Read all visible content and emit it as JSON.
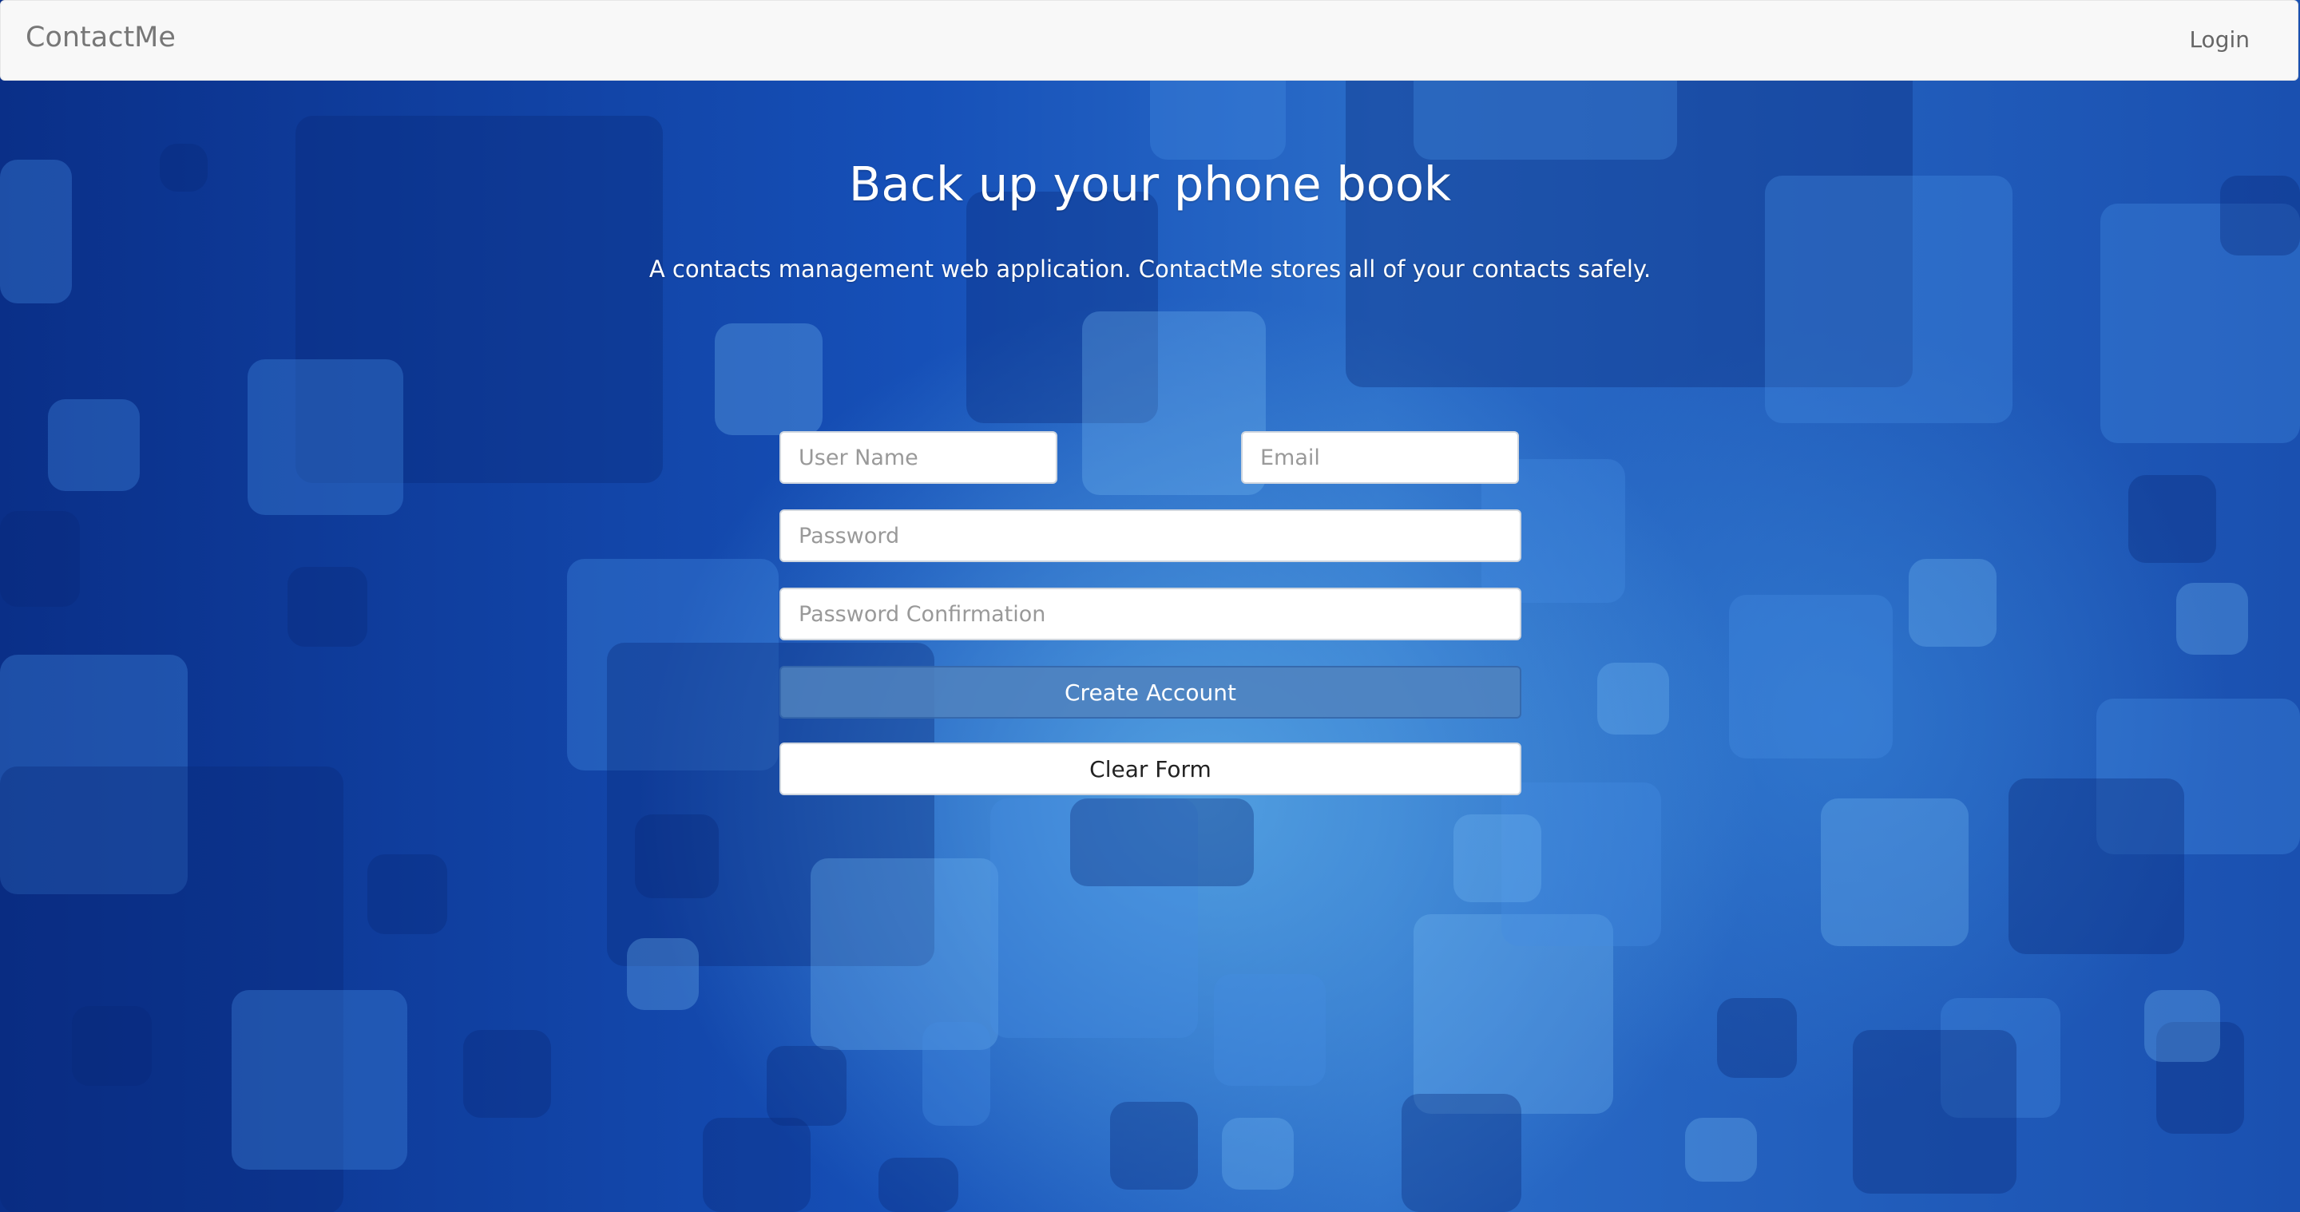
{
  "navbar": {
    "brand": "ContactMe",
    "login_label": "Login"
  },
  "hero": {
    "title": "Back up your phone book",
    "subtitle": "A contacts management web application. ContactMe stores all of your contacts safely."
  },
  "form": {
    "username_placeholder": "User Name",
    "email_placeholder": "Email",
    "password_placeholder": "Password",
    "password_confirmation_placeholder": "Password Confirmation",
    "create_label": "Create Account",
    "clear_label": "Clear Form"
  },
  "colors": {
    "navbar_bg": "#f8f8f8",
    "background_blue": "#1650b8",
    "create_button": "#5082be"
  }
}
